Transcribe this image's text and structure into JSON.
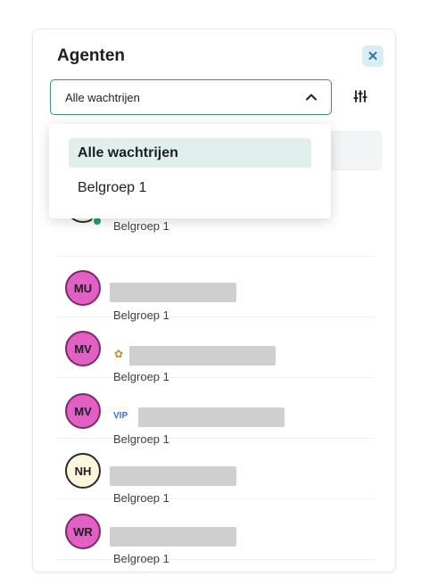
{
  "panel": {
    "title": "Agenten",
    "close_glyph": "✕",
    "queue_select": {
      "value": "Alle wachtrijen",
      "icon": "chevron-up-icon"
    },
    "filter_icon": "sliders-icon"
  },
  "dropdown": {
    "options": [
      "Alle wachtrijen",
      "Belgroep 1"
    ],
    "selected": "Alle wachtrijen"
  },
  "agents": [
    {
      "initials": "",
      "group": "Belgroep 1",
      "online": true
    },
    {
      "initials": "MU",
      "group": "Belgroep 1"
    },
    {
      "initials": "MV",
      "group": "Belgroep 1",
      "badge": "star"
    },
    {
      "initials": "MV",
      "group": "Belgroep 1",
      "badge": "VIP"
    },
    {
      "initials": "NH",
      "group": "Belgroep 1"
    },
    {
      "initials": "WR",
      "group": "Belgroep 1"
    }
  ],
  "colors": {
    "accent": "#3d8f86",
    "avatar_pink": "#e25fc4",
    "avatar_cream": "#fdf6dc",
    "vip_blue": "#3b6fd6",
    "online_green": "#23a35a"
  }
}
